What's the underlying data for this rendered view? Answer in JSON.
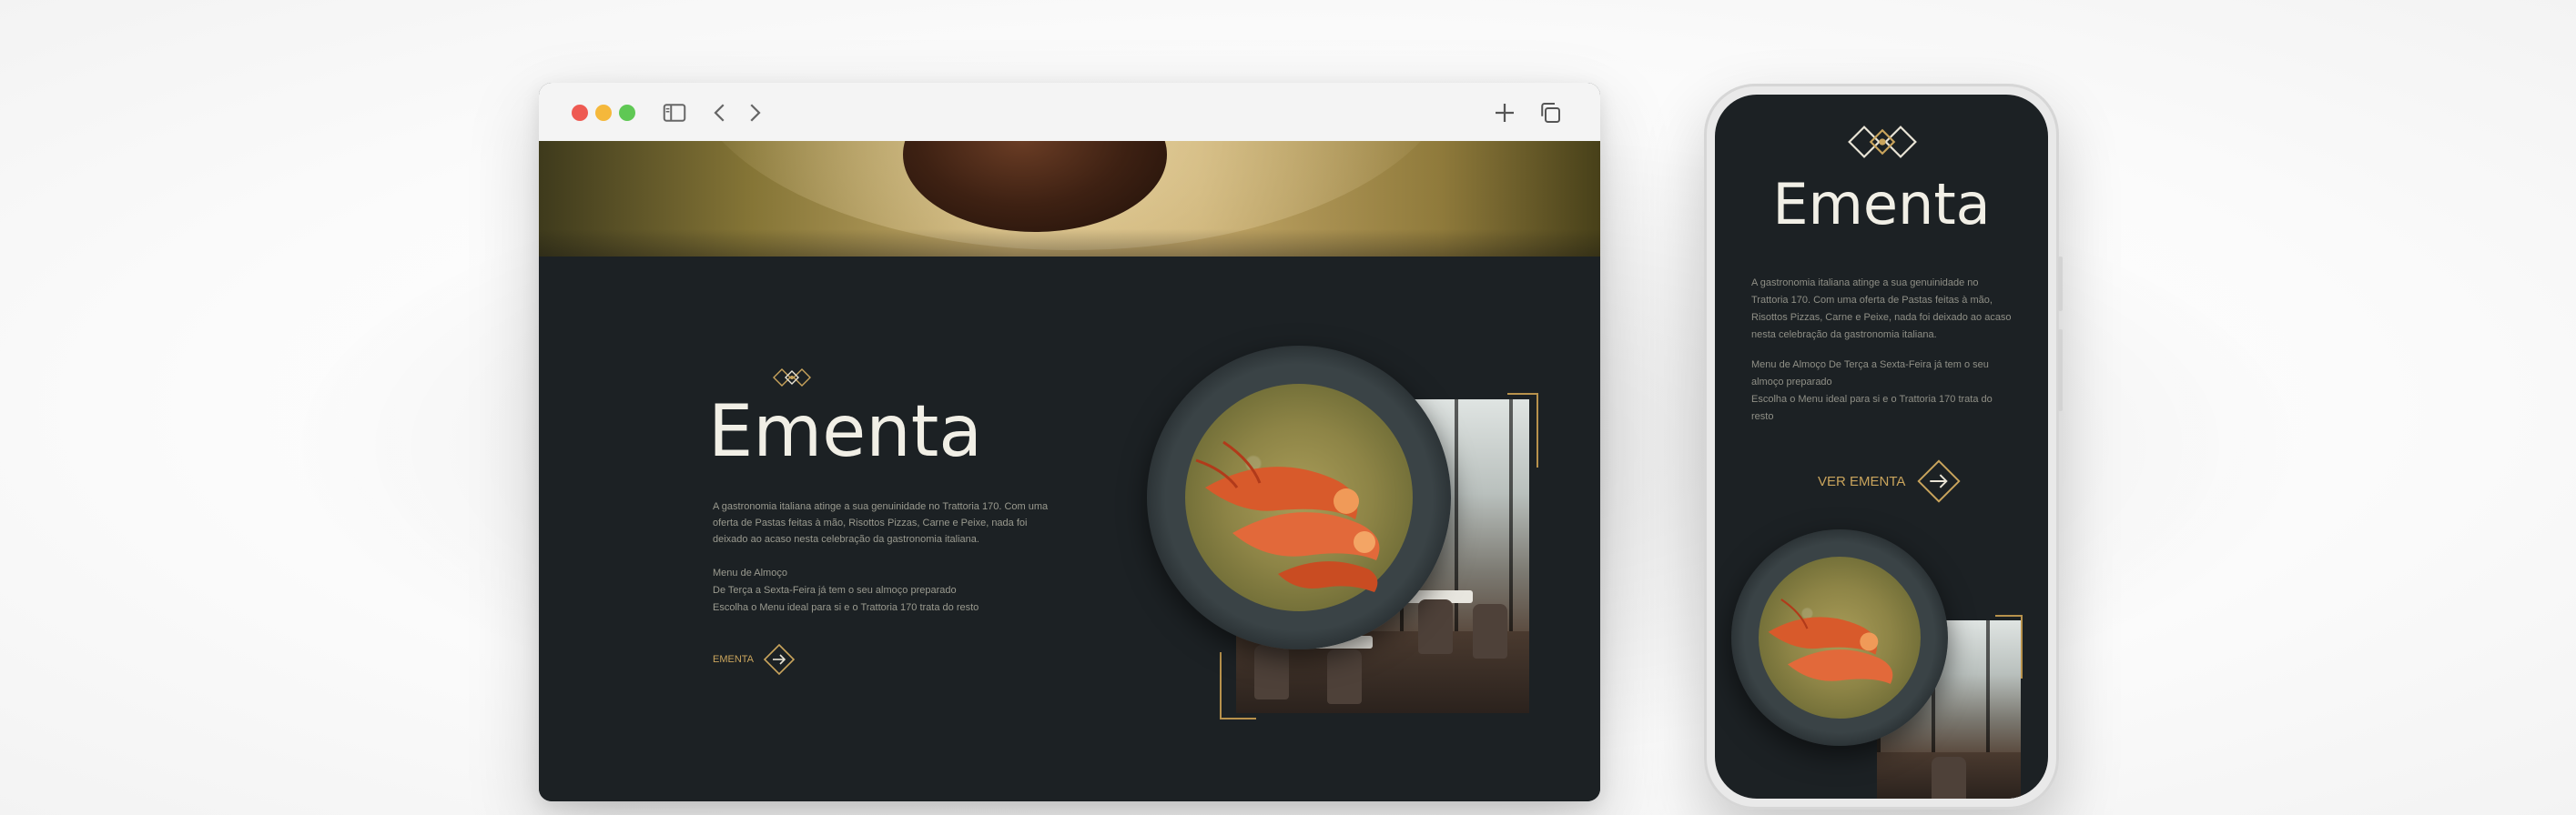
{
  "browser": {
    "traffic_lights": [
      "#ee5a52",
      "#f5b83b",
      "#5fc854"
    ],
    "icons": [
      "sidebar-icon",
      "chevron-left-icon",
      "chevron-right-icon",
      "plus-icon",
      "copy-tabs-icon"
    ]
  },
  "section": {
    "title": "Ementa",
    "description": "A gastronomia italiana atinge a sua genuinidade no Trattoria 170. Com uma oferta de Pastas feitas à mão, Risottos Pizzas, Carne e Peixe, nada foi deixado ao acaso nesta celebração da gastronomia italiana.",
    "menu_lines": [
      "Menu de Almoço",
      "De Terça a Sexta-Feira já tem o seu almoço preparado",
      "Escolha o Menu ideal para si e o Trattoria 170 trata do resto"
    ],
    "cta_label": "EMENTA"
  },
  "mobile": {
    "title": "Ementa",
    "description": "A gastronomia italiana atinge a sua genuinidade no Trattoria 170. Com uma oferta de Pastas feitas à mão, Risottos Pizzas, Carne e Peixe, nada foi deixado ao acaso nesta celebração da gastronomia italiana.",
    "menu_lines": [
      "Menu de Almoço De Terça a Sexta-Feira já tem o seu almoço preparado",
      "Escolha o Menu ideal para si e o Trattoria 170 trata do resto"
    ],
    "cta_label": "VER EMENTA"
  },
  "colors": {
    "background": "#1c2124",
    "accent_gold": "#c9a45c",
    "title": "#f1efe6",
    "body_text": "#9a9a8f"
  }
}
